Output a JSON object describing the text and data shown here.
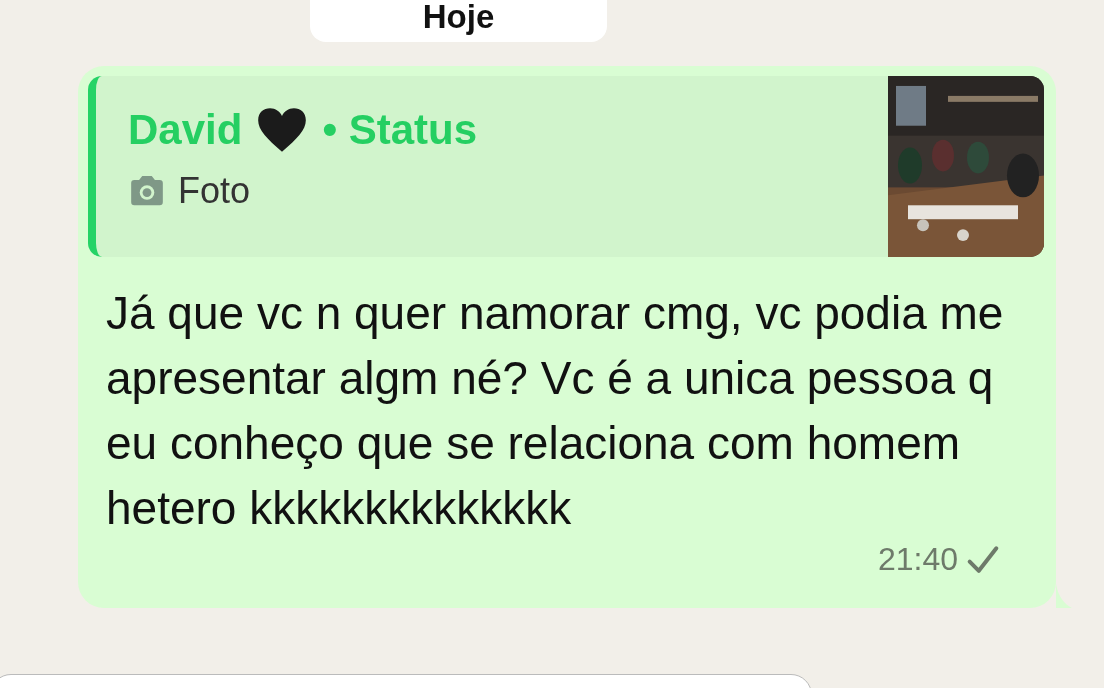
{
  "date_chip": "Hoje",
  "message": {
    "reply": {
      "author": "David",
      "context": "• Status",
      "media_label": "Foto"
    },
    "text": "Já que vc n quer namorar cmg, vc podia me apresentar algm né? Vc é a unica pessoa q eu conheço que se relaciona com homem hetero kkkkkkkkkkkkkk",
    "time": "21:40",
    "read": false
  }
}
